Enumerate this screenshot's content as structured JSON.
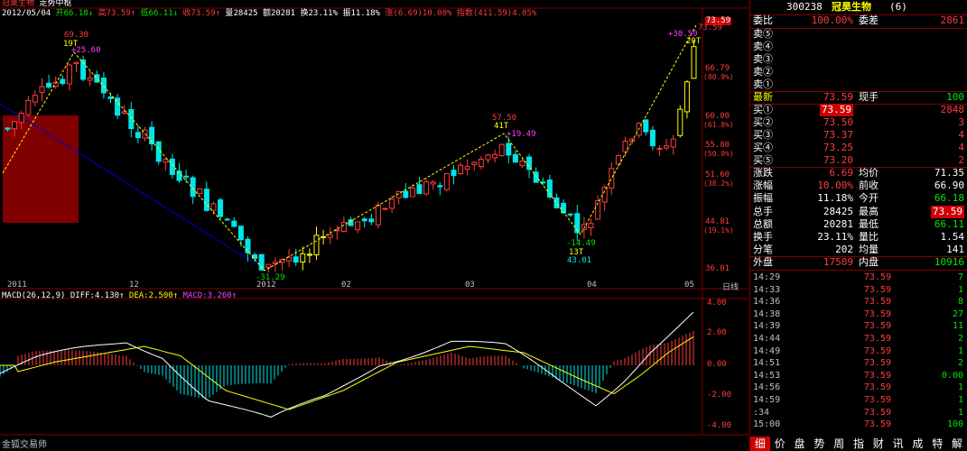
{
  "header": {
    "name": "冠昊生物",
    "tool": "走势中枢",
    "date": "2012/05/04",
    "open_label": "开",
    "open": "66.18",
    "high_label": "高",
    "high": "73.59",
    "low_label": "低",
    "low": "66.11",
    "close_label": "收",
    "close": "73.59",
    "volume_label": "量",
    "volume": "28425",
    "amount_label": "额",
    "amount": "20281",
    "turnover_label": "换",
    "turnover": "23.11%",
    "amplitude_label": "振",
    "amplitude": "11.18%",
    "change_label": "涨",
    "change": "(6.69)10.00%",
    "index_label": "指数",
    "index": "(411.59)4.05%"
  },
  "price_axis": {
    "labels": [
      {
        "value": "73.59",
        "sub": ""
      },
      {
        "value": "66.79",
        "sub": "(80.9%)"
      },
      {
        "value": "60.00",
        "sub": "(61.8%)"
      },
      {
        "value": "55.80",
        "sub": "(50.0%)"
      },
      {
        "value": "51.60",
        "sub": "(38.2%)"
      },
      {
        "value": "44.81",
        "sub": "(19.1%)"
      },
      {
        "value": "36.01",
        "sub": ""
      }
    ]
  },
  "time_axis": [
    "2011",
    "12",
    "2012",
    "02",
    "03",
    "04",
    "05"
  ],
  "axis_corner": "日线",
  "annotations": {
    "peak1_price": "69.30",
    "peak1_count": "19T",
    "peak1_pct": "+25.60",
    "trough1_pct": "-31.29",
    "peak2_price": "57.50",
    "peak2_count": "41T",
    "peak2_pct": "+19.49",
    "trough2_pct": "-14.49",
    "trough2_count": "13T",
    "trough2_price": "43.01",
    "peak3_price": "73.59",
    "peak3_pct": "+30.59",
    "peak3_count": "20T"
  },
  "macd": {
    "title": "MACD(26,12,9)",
    "diff_label": "DIFF:",
    "diff": "4.130",
    "dea_label": "DEA:",
    "dea": "2.500",
    "macd_label": "MACD:",
    "macd": "3.260",
    "axis": [
      "4.00",
      "2.00",
      "0.00",
      "-2.00",
      "-4.00"
    ]
  },
  "footer": {
    "brand": "金狐交易师"
  },
  "colors": {
    "up": "#ff3c3c",
    "down": "#00e6e6",
    "diff": "#ffffff",
    "dea": "#ffff00",
    "trend": "#ffff00",
    "channel": "#0000cc",
    "box": "#800000"
  },
  "quote": {
    "code": "300238",
    "name": "冠昊生物",
    "name_suffix": "(6)",
    "weibi_label": "委比",
    "weibi": "100.00%",
    "weicha_label": "委差",
    "weicha": "2861",
    "sell": [
      {
        "label": "卖⑤",
        "price": "",
        "vol": ""
      },
      {
        "label": "卖④",
        "price": "",
        "vol": ""
      },
      {
        "label": "卖③",
        "price": "",
        "vol": ""
      },
      {
        "label": "卖②",
        "price": "",
        "vol": ""
      },
      {
        "label": "卖①",
        "price": "",
        "vol": ""
      }
    ],
    "latest_label": "最新",
    "latest": "73.59",
    "current_vol_label": "现手",
    "current_vol": "100",
    "buy": [
      {
        "label": "买①",
        "price": "73.59",
        "vol": "2848"
      },
      {
        "label": "买②",
        "price": "73.50",
        "vol": "3"
      },
      {
        "label": "买③",
        "price": "73.37",
        "vol": "4"
      },
      {
        "label": "买④",
        "price": "73.25",
        "vol": "4"
      },
      {
        "label": "买⑤",
        "price": "73.20",
        "vol": "2"
      }
    ],
    "stats": [
      {
        "l1": "涨跌",
        "v1": "6.69",
        "c1": "red",
        "l2": "均价",
        "v2": "71.35",
        "c2": "white"
      },
      {
        "l1": "涨幅",
        "v1": "10.00%",
        "c1": "red",
        "l2": "前收",
        "v2": "66.90",
        "c2": "white"
      },
      {
        "l1": "振幅",
        "v1": "11.18%",
        "c1": "white",
        "l2": "今开",
        "v2": "66.18",
        "c2": "green"
      },
      {
        "l1": "总手",
        "v1": "28425",
        "c1": "white",
        "l2": "最高",
        "v2": "73.59",
        "c2": "redbox"
      },
      {
        "l1": "总额",
        "v1": "20281",
        "c1": "white",
        "l2": "最低",
        "v2": "66.11",
        "c2": "green"
      },
      {
        "l1": "换手",
        "v1": "23.11%",
        "c1": "white",
        "l2": "量比",
        "v2": "1.54",
        "c2": "white"
      },
      {
        "l1": "分笔",
        "v1": "202",
        "c1": "white",
        "l2": "均量",
        "v2": "141",
        "c2": "white"
      }
    ],
    "outer_label": "外盘",
    "outer": "17509",
    "inner_label": "内盘",
    "inner": "10916",
    "ticks": [
      {
        "time": "14:29",
        "price": "73.59",
        "vol": "7"
      },
      {
        "time": "14:33",
        "price": "73.59",
        "vol": "1"
      },
      {
        "time": "14:36",
        "price": "73.59",
        "vol": "8"
      },
      {
        "time": "14:38",
        "price": "73.59",
        "vol": "27"
      },
      {
        "time": "14:39",
        "price": "73.59",
        "vol": "11"
      },
      {
        "time": "14:44",
        "price": "73.59",
        "vol": "2"
      },
      {
        "time": "14:49",
        "price": "73.59",
        "vol": "1"
      },
      {
        "time": "14:51",
        "price": "73.59",
        "vol": "2"
      },
      {
        "time": "14:53",
        "price": "73.59",
        "vol": "0.00"
      },
      {
        "time": "14:56",
        "price": "73.59",
        "vol": "1"
      },
      {
        "time": "14:59",
        "price": "73.59",
        "vol": "1"
      },
      {
        "time": ":34",
        "price": "73.59",
        "vol": "1"
      },
      {
        "time": "15:00",
        "price": "73.59",
        "vol": "100"
      }
    ],
    "tabs": [
      "细",
      "价",
      "盘",
      "势",
      "周",
      "指",
      "财",
      "讯",
      "成",
      "特",
      "解"
    ]
  }
}
